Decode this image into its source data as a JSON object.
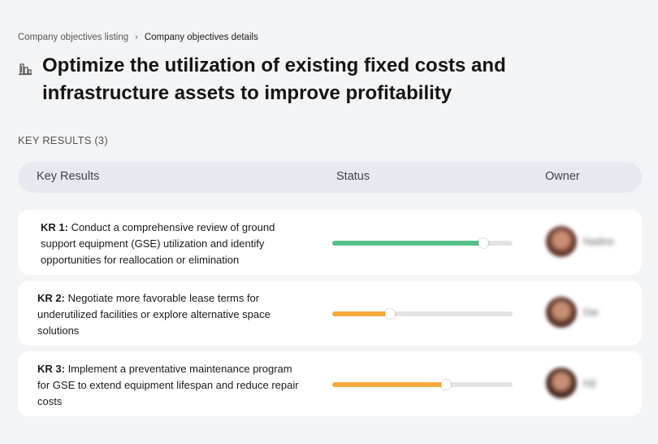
{
  "breadcrumb": {
    "parent": "Company objectives listing",
    "separator": "›",
    "current": "Company objectives details"
  },
  "objective": {
    "icon": "building-chart-icon",
    "title": "Optimize the utilization of existing fixed costs and infrastructure assets to improve profitability"
  },
  "key_results_label": "KEY RESULTS (3)",
  "table": {
    "headers": {
      "key_results": "Key Results",
      "status": "Status",
      "owner": "Owner"
    },
    "rows": [
      {
        "prefix": "KR 1:",
        "text": "Conduct a comprehensive review of ground support equipment (GSE) utilization and identify opportunities for reallocation or elimination",
        "progress": 0.84,
        "status_color": "#55c08a",
        "owner_name": "Nadine",
        "avatar_color": "#6b3a2e"
      },
      {
        "prefix": "KR 2:",
        "text": "Negotiate more favorable lease terms for underutilized facilities or explore alternative space solutions",
        "progress": 0.32,
        "status_color": "#f7a93b",
        "owner_name": "Dai",
        "avatar_color": "#5a3528"
      },
      {
        "prefix": "KR 3:",
        "text": "Implement a preventative maintenance program for GSE to extend equipment lifespan and reduce repair costs",
        "progress": 0.63,
        "status_color": "#f7a93b",
        "owner_name": "Inji",
        "avatar_color": "#4a2a22"
      }
    ]
  }
}
